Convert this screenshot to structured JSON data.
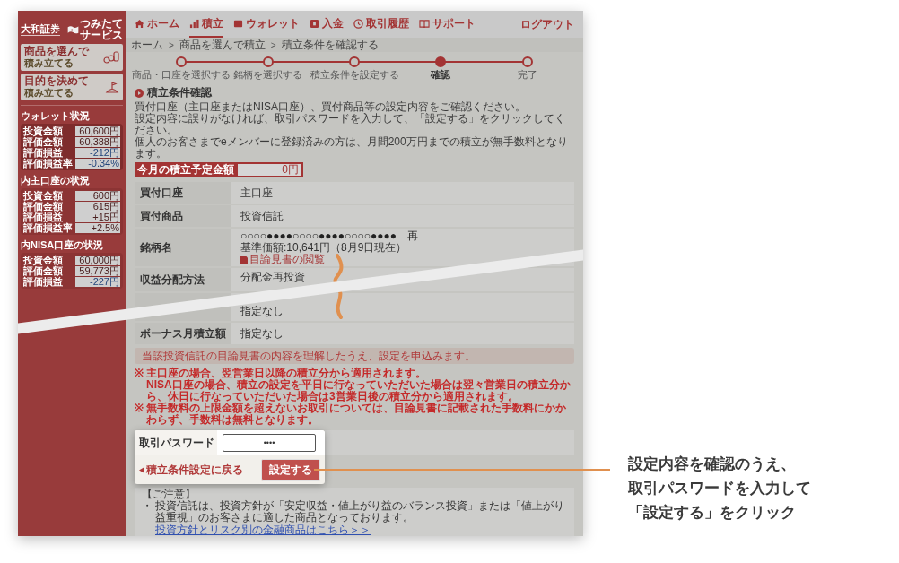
{
  "sidebar": {
    "logo": "大和証券",
    "service_name": [
      "つみたて",
      "サービス"
    ],
    "menu_buttons": [
      {
        "lines": [
          "商品を選んで",
          "積み立てる"
        ]
      },
      {
        "lines": [
          "目的を決めて",
          "積み立てる"
        ]
      }
    ],
    "sections": [
      {
        "title": "ウォレット状況",
        "rows": [
          {
            "label": "投資金額",
            "value": "60,600円",
            "negative": false
          },
          {
            "label": "評価金額",
            "value": "60,388円",
            "negative": false
          },
          {
            "label": "評価損益",
            "value": "-212円",
            "negative": true
          },
          {
            "label": "評価損益率",
            "value": "-0.34%",
            "negative": true
          }
        ]
      },
      {
        "title": "内主口座の状況",
        "rows": [
          {
            "label": "投資金額",
            "value": "600円",
            "negative": false
          },
          {
            "label": "評価金額",
            "value": "615円",
            "negative": false
          },
          {
            "label": "評価損益",
            "value": "+15円",
            "negative": false
          },
          {
            "label": "評価損益率",
            "value": "+2.5%",
            "negative": false
          }
        ]
      },
      {
        "title": "内NISA口座の状況",
        "rows": [
          {
            "label": "投資金額",
            "value": "60,000円",
            "negative": false
          },
          {
            "label": "評価金額",
            "value": "59,773円",
            "negative": false
          },
          {
            "label": "評価損益",
            "value": "-227円",
            "negative": true
          }
        ]
      }
    ]
  },
  "nav": {
    "items": [
      {
        "label": "ホーム",
        "selected": false
      },
      {
        "label": "積立",
        "selected": true
      },
      {
        "label": "ウォレット",
        "selected": false
      },
      {
        "label": "入金",
        "selected": false
      },
      {
        "label": "取引履歴",
        "selected": false
      },
      {
        "label": "サポート",
        "selected": false
      }
    ],
    "logout": "ログアウト"
  },
  "breadcrumb": {
    "separator": ">",
    "items": [
      "ホーム",
      "商品を選んで積立",
      "積立条件を確認する"
    ]
  },
  "steps": [
    {
      "label": "商品・口座を選択する",
      "current": false
    },
    {
      "label": "銘柄を選択する",
      "current": false
    },
    {
      "label": "積立条件を設定する",
      "current": false
    },
    {
      "label": "確認",
      "current": true
    },
    {
      "label": "完了",
      "current": false
    }
  ],
  "heading": "積立条件確認",
  "intro": [
    "買付口座（主口座またはNISA口座）、買付商品等の設定内容をご確認ください。",
    "設定内容に誤りがなければ、取引パスワードを入力して、「設定する」をクリックしてください。",
    "個人のお客さまでeメンバーに登録済みの方は、月間200万円までの積立が無手数料となります。"
  ],
  "monthly_amount": {
    "label": "今月の積立予定金額",
    "value": "0円"
  },
  "table": {
    "rows": [
      {
        "kind": "text",
        "label": "買付口座",
        "value": "主口座"
      },
      {
        "kind": "text",
        "label": "買付商品",
        "value": "投資信託"
      },
      {
        "kind": "fund",
        "label": "銘柄名",
        "value": "○○○○●●●●○○○○●●●●○○○○●●●●　再",
        "price": "基準価額:10,641円（8月9日現在）",
        "link": "目論見書の閲覧"
      },
      {
        "kind": "text",
        "label": "収益分配方法",
        "value": "分配金再投資"
      },
      {
        "kind": "text",
        "value": "指定なし"
      },
      {
        "kind": "text",
        "label": "ボーナス月積立額",
        "value": "指定なし"
      }
    ]
  },
  "notice": "当該投資信託の目論見書の内容を理解したうえ、設定を申込みます。",
  "notes": [
    {
      "mark": "※",
      "lines": [
        "主口座の場合、翌営業日以降の積立分から適用されます。",
        "NISA口座の場合、積立の設定を平日に行なっていただいた場合は翌々営業日の積立分から、休日に行なっていただいた場合は3営業日後の積立分から適用されます。"
      ]
    },
    {
      "mark": "※",
      "lines": [
        "無手数料の上限金額を超えないお取引については、目論見書に記載された手数料にかかわらず、手数料は無料となります。"
      ]
    }
  ],
  "password": {
    "label": "取引パスワード",
    "value": "••••"
  },
  "back_link": "積立条件設定に戻る",
  "submit_button": "設定する",
  "caution": {
    "title": "【ご注意】",
    "bullet": "・",
    "text": "投資信託は、投資方針が「安定収益・値上がり益のバランス投資」または「値上がり益重視」のお客さまに適した商品となっております。",
    "link": "投資方針とリスク別の金融商品はこちら＞＞"
  },
  "annotation": [
    "設定内容を確認のうえ、",
    "取引パスワードを入力して",
    "「設定する」をクリック"
  ]
}
